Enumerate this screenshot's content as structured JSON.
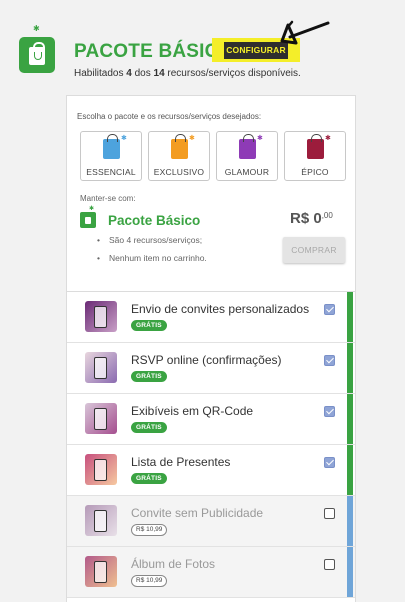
{
  "header": {
    "title": "PACOTE BÁSICO",
    "configure_label": "CONFIGURAR",
    "subtitle_pre": "Habilitados ",
    "enabled_count": "4",
    "subtitle_mid": " dos ",
    "total_count": "14",
    "subtitle_post": " recursos/serviços disponíveis."
  },
  "chooser": {
    "label": "Escolha o pacote e os recursos/serviços desejados:",
    "packages": [
      {
        "label": "ESSENCIAL",
        "color": "#4da3dd"
      },
      {
        "label": "EXCLUSIVO",
        "color": "#f39c21"
      },
      {
        "label": "GLAMOUR",
        "color": "#8e3bb6"
      },
      {
        "label": "ÉPICO",
        "color": "#9c1c3c"
      }
    ]
  },
  "current": {
    "keep_label": "Manter-se com:",
    "title": "Pacote Básico",
    "price_main": "R$ 0",
    "price_cents": ",00",
    "bullets": [
      "São 4 recursos/serviços;",
      "Nenhum item no carrinho."
    ],
    "buy_label": "COMPRAR"
  },
  "services": [
    {
      "name": "Envio de convites personalizados",
      "badge": "GRÁTIS",
      "checked": true,
      "thumb": "envelopes"
    },
    {
      "name": "RSVP online (confirmações)",
      "badge": "GRÁTIS",
      "checked": true,
      "thumb": "phone"
    },
    {
      "name": "Exibíveis em QR-Code",
      "badge": "GRÁTIS",
      "checked": true,
      "thumb": "qr-phone"
    },
    {
      "name": "Lista de Presentes",
      "badge": "GRÁTIS",
      "checked": true,
      "thumb": "gifts"
    },
    {
      "name": "Convite sem Publicidade",
      "badge": "R$ 10,99",
      "checked": false,
      "thumb": "phone-hand"
    },
    {
      "name": "Álbum de Fotos",
      "badge": "R$ 10,99",
      "checked": false,
      "thumb": "photo-phone"
    }
  ],
  "colors": {
    "accent_green": "#3aa342",
    "stripe_included": "#3aa342",
    "stripe_optional": "#6fa5d8",
    "highlight_yellow": "#f4ee29"
  }
}
